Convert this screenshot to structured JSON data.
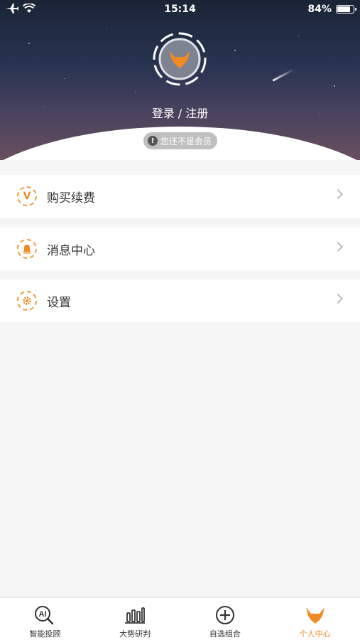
{
  "status_bar": {
    "time": "15:14",
    "battery": "84%",
    "battery_level": 0.84
  },
  "profile": {
    "login_label": "登录 / 注册",
    "member_status": "您还不是会员",
    "avatar_icon": "bull-logo-icon"
  },
  "menu": {
    "items": [
      {
        "label": "购买续费",
        "icon": "vip-icon"
      },
      {
        "label": "消息中心",
        "icon": "bell-icon"
      },
      {
        "label": "设置",
        "icon": "gear-icon"
      }
    ]
  },
  "tab_bar": {
    "tabs": [
      {
        "label": "智能投顾",
        "icon": "ai-search-icon"
      },
      {
        "label": "大势研判",
        "icon": "bar-chart-icon"
      },
      {
        "label": "自选组合",
        "icon": "plus-circle-icon"
      },
      {
        "label": "个人中心",
        "icon": "bull-logo-icon",
        "active": true
      }
    ]
  },
  "colors": {
    "accent": "#f08a24",
    "background": "#f5f5f5"
  }
}
